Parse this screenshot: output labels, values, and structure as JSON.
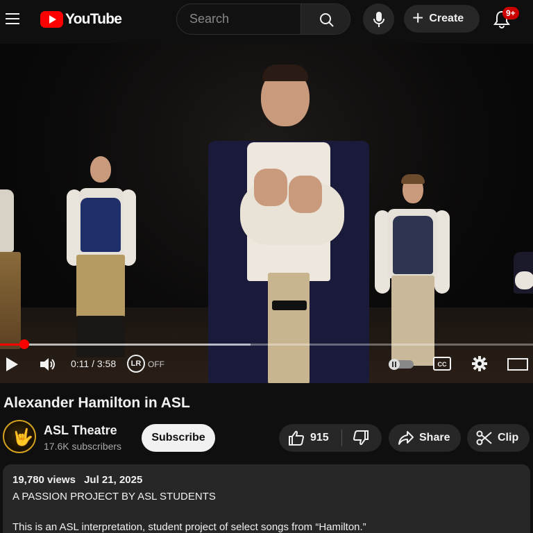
{
  "header": {
    "logo_text": "YouTube",
    "search_placeholder": "Search",
    "create_label": "Create",
    "notifications_badge": "9+"
  },
  "player": {
    "current_time": "0:11",
    "duration": "3:58",
    "time_display": "0:11 / 3:58",
    "lr_label": "LR",
    "lr_state": "OFF",
    "progress_fraction": 0.046,
    "buffered_fraction": 0.47
  },
  "video": {
    "title": "Alexander Hamilton in ASL"
  },
  "channel": {
    "name": "ASL Theatre",
    "subscribers": "17.6K subscribers",
    "subscribe_label": "Subscribe"
  },
  "actions": {
    "like_count": "915",
    "share_label": "Share",
    "clip_label": "Clip"
  },
  "description": {
    "views": "19,780 views",
    "date": "Jul 21, 2025",
    "line1": "A PASSION PROJECT BY ASL STUDENTS",
    "line2": "This is an ASL interpretation, student project of select songs from “Hamilton.”"
  },
  "colors": {
    "brand_red": "#ff0000",
    "background": "#0f0f0f",
    "pill": "#272727"
  }
}
